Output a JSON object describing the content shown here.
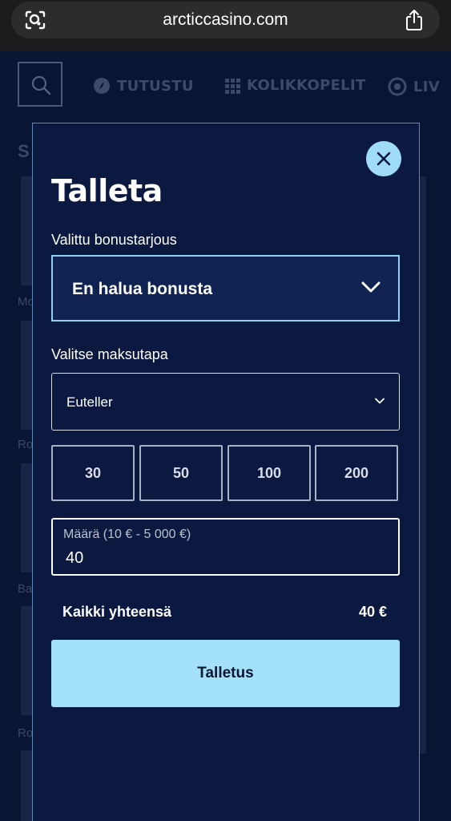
{
  "browser": {
    "url": "arcticcasino.com",
    "lens_icon": "camera-search-icon",
    "share_icon": "share-icon"
  },
  "site": {
    "nav": [
      {
        "label": "TUTUSTU",
        "icon": "compass-icon"
      },
      {
        "label": "KOLIKKOPELIT",
        "icon": "grid-dots-icon"
      },
      {
        "label": "LIV",
        "icon": "roulette-icon"
      }
    ],
    "background_text": [
      "S",
      "Mo",
      "Ro",
      "Ba",
      "Ro"
    ]
  },
  "modal": {
    "title": "Talleta",
    "close_icon": "close-icon",
    "bonus": {
      "label": "Valittu bonustarjous",
      "value": "En halua bonusta"
    },
    "payment": {
      "label": "Valitse maksutapa",
      "value": "Euteller"
    },
    "quick_amounts": [
      "30",
      "50",
      "100",
      "200"
    ],
    "amount": {
      "label": "Määrä (10 € - 5 000 €)",
      "value": "40"
    },
    "total": {
      "label": "Kaikki yhteensä",
      "value": "40 €"
    },
    "submit_label": "Talletus"
  },
  "colors": {
    "background": "#0a1433",
    "modal_bg": "#0b1840",
    "accent": "#a3e1fa",
    "selected_border": "#8fd0f2"
  }
}
